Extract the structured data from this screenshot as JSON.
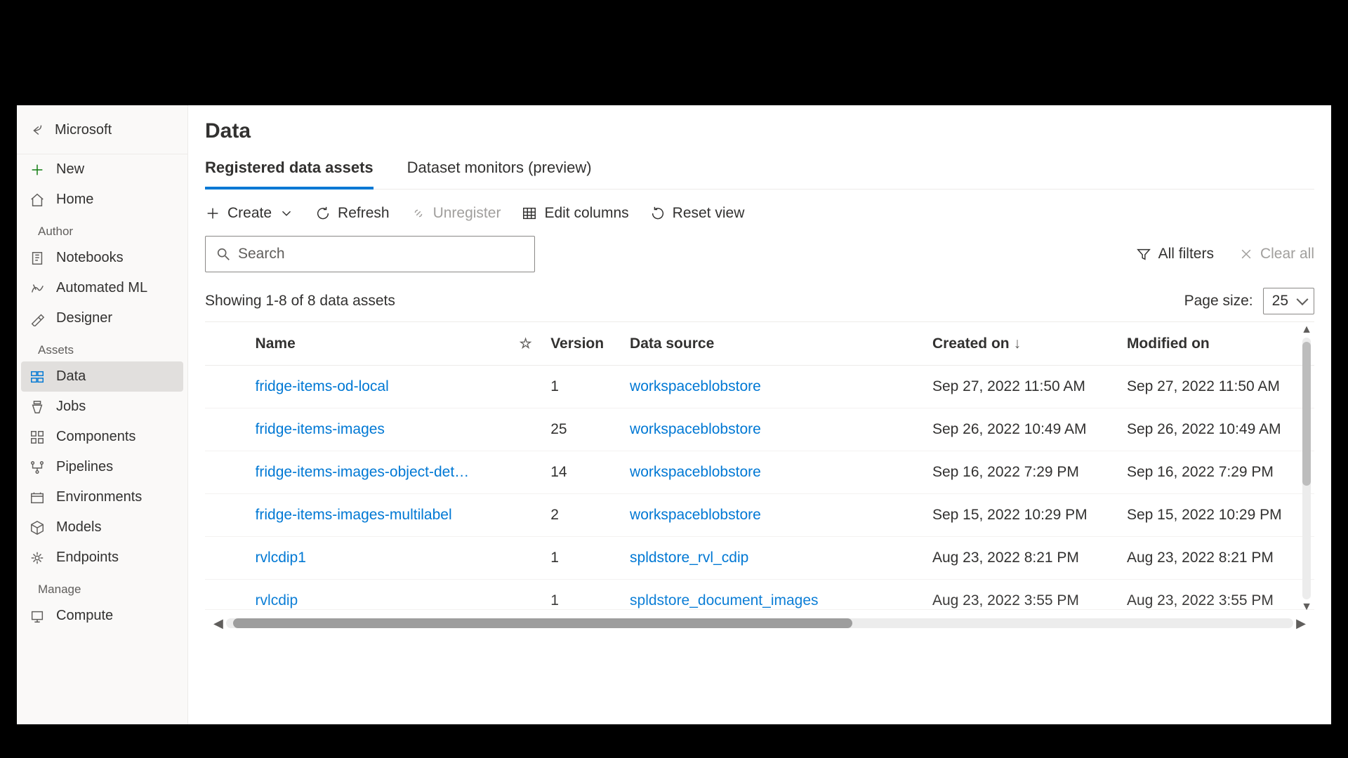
{
  "header": {
    "workspace": "Microsoft"
  },
  "sidebar": {
    "new_label": "New",
    "home_label": "Home",
    "sections": {
      "author": "Author",
      "assets": "Assets",
      "manage": "Manage"
    },
    "author": {
      "notebooks": "Notebooks",
      "automl": "Automated ML",
      "designer": "Designer"
    },
    "assets": {
      "data": "Data",
      "jobs": "Jobs",
      "components": "Components",
      "pipelines": "Pipelines",
      "environments": "Environments",
      "models": "Models",
      "endpoints": "Endpoints"
    },
    "manage": {
      "compute": "Compute"
    }
  },
  "page": {
    "title": "Data",
    "tabs": [
      {
        "label": "Registered data assets"
      },
      {
        "label": "Dataset monitors (preview)"
      }
    ]
  },
  "toolbar": {
    "create": "Create",
    "refresh": "Refresh",
    "unregister": "Unregister",
    "edit_columns": "Edit columns",
    "reset_view": "Reset view"
  },
  "search": {
    "placeholder": "Search"
  },
  "filters": {
    "all_filters": "All filters",
    "clear_all": "Clear all"
  },
  "status": {
    "showing": "Showing 1-8 of 8 data assets",
    "page_size_label": "Page size:",
    "page_size_value": "25"
  },
  "table": {
    "columns": {
      "name": "Name",
      "version": "Version",
      "data_source": "Data source",
      "created_on": "Created on",
      "modified_on": "Modified on"
    },
    "rows": [
      {
        "name": "fridge-items-od-local",
        "version": "1",
        "data_source": "workspaceblobstore",
        "created_on": "Sep 27, 2022 11:50 AM",
        "modified_on": "Sep 27, 2022 11:50 AM"
      },
      {
        "name": "fridge-items-images",
        "version": "25",
        "data_source": "workspaceblobstore",
        "created_on": "Sep 26, 2022 10:49 AM",
        "modified_on": "Sep 26, 2022 10:49 AM"
      },
      {
        "name": "fridge-items-images-object-det…",
        "version": "14",
        "data_source": "workspaceblobstore",
        "created_on": "Sep 16, 2022 7:29 PM",
        "modified_on": "Sep 16, 2022 7:29 PM"
      },
      {
        "name": "fridge-items-images-multilabel",
        "version": "2",
        "data_source": "workspaceblobstore",
        "created_on": "Sep 15, 2022 10:29 PM",
        "modified_on": "Sep 15, 2022 10:29 PM"
      },
      {
        "name": "rvlcdip1",
        "version": "1",
        "data_source": "spldstore_rvl_cdip",
        "created_on": "Aug 23, 2022 8:21 PM",
        "modified_on": "Aug 23, 2022 8:21 PM"
      },
      {
        "name": "rvlcdip",
        "version": "1",
        "data_source": "spldstore_document_images",
        "created_on": "Aug 23, 2022 3:55 PM",
        "modified_on": "Aug 23, 2022 3:55 PM"
      }
    ]
  }
}
